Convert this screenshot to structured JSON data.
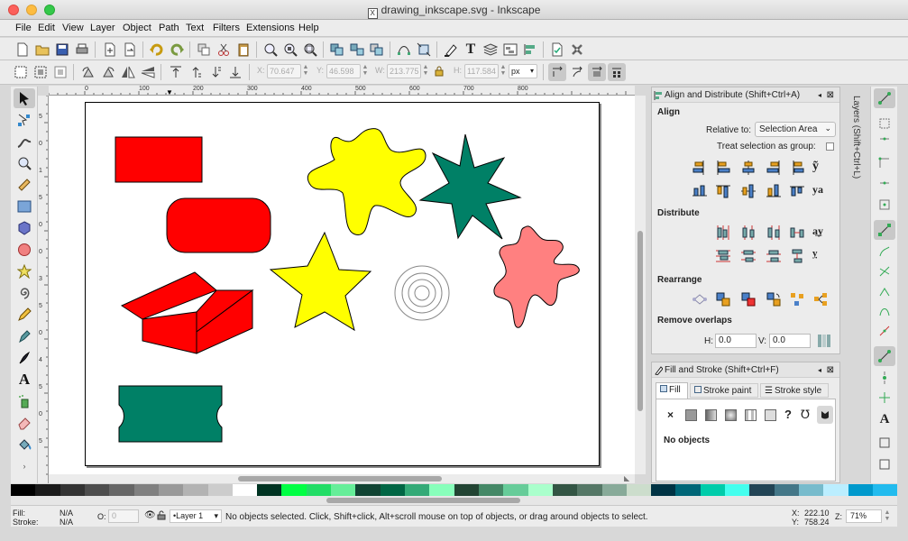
{
  "window": {
    "title": "drawing_inkscape.svg - Inkscape"
  },
  "menu": [
    "File",
    "Edit",
    "View",
    "Layer",
    "Object",
    "Path",
    "Text",
    "Filters",
    "Extensions",
    "Help"
  ],
  "controls": {
    "x_label": "X:",
    "x_value": "70.647",
    "y_label": "Y:",
    "y_value": "46.598",
    "w_label": "W:",
    "w_value": "213.775",
    "h_label": "H:",
    "h_value": "117.584",
    "unit": "px"
  },
  "ruler": {
    "h_ticks": [
      "0",
      "100",
      "200",
      "300",
      "400",
      "500",
      "600",
      "700",
      "800"
    ],
    "v_ticks": [
      "5",
      "0",
      "1",
      "5",
      "0",
      "0",
      "3",
      "5",
      "0",
      "4",
      "5",
      "0",
      "5"
    ]
  },
  "align_panel": {
    "title": "Align and Distribute (Shift+Ctrl+A)",
    "align_heading": "Align",
    "relative_label": "Relative to:",
    "relative_value": "Selection Area",
    "treat_label": "Treat selection as group:",
    "distribute_heading": "Distribute",
    "rearrange_heading": "Rearrange",
    "overlaps_heading": "Remove overlaps",
    "h_label": "H:",
    "h_value": "0.0",
    "v_label": "V:",
    "v_value": "0.0"
  },
  "fill_panel": {
    "title": "Fill and Stroke (Shift+Ctrl+F)",
    "tab_fill": "Fill",
    "tab_stroke_paint": "Stroke paint",
    "tab_stroke_style": "Stroke style",
    "unset_glyph": "×",
    "unknown_glyph": "?",
    "message": "No objects"
  },
  "layers_tab": "Layers (Shift+Ctrl+L)",
  "status": {
    "fill_label": "Fill:",
    "fill_value": "N/A",
    "stroke_label": "Stroke:",
    "stroke_value": "N/A",
    "opacity_label": "O:",
    "opacity_value": "0",
    "layer": "•Layer 1",
    "message": "No objects selected. Click, Shift+click, Alt+scroll mouse on top of objects, or drag around objects to select.",
    "x_label": "X:",
    "x_value": "222.10",
    "y_label": "Y:",
    "y_value": "758.24",
    "z_label": "Z:",
    "zoom": "71%"
  },
  "colors": {
    "red": "#ff0000",
    "yellow": "#ffff00",
    "green": "#008066",
    "pink": "#ff8080"
  }
}
